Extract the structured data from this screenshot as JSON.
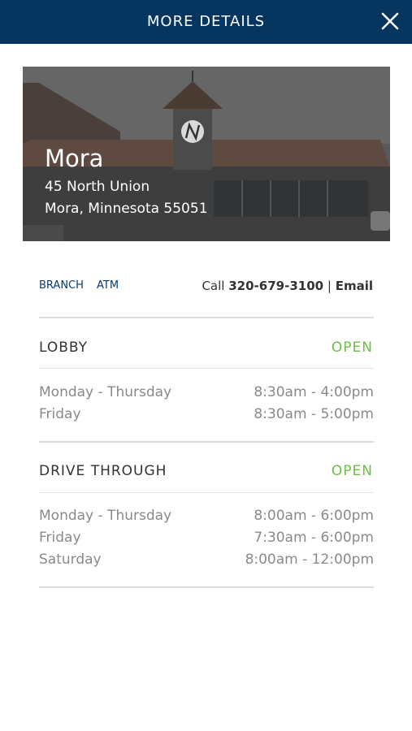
{
  "header": {
    "title": "MORE DETAILS"
  },
  "location": {
    "name": "Mora",
    "address_line1": "45 North Union",
    "address_line2": "Mora, Minnesota 55051"
  },
  "tags": [
    "BRANCH",
    "ATM"
  ],
  "contact": {
    "call_label": "Call",
    "phone": "320-679-3100",
    "separator": "|",
    "email_label": "Email"
  },
  "sections": [
    {
      "title": "LOBBY",
      "status": "OPEN",
      "hours": [
        {
          "day": "Monday - Thursday",
          "time": "8:30am - 4:00pm"
        },
        {
          "day": "Friday",
          "time": "8:30am - 5:00pm"
        }
      ]
    },
    {
      "title": "DRIVE THROUGH",
      "status": "OPEN",
      "hours": [
        {
          "day": "Monday - Thursday",
          "time": "8:00am - 6:00pm"
        },
        {
          "day": "Friday",
          "time": "7:30am - 6:00pm"
        },
        {
          "day": "Saturday",
          "time": "8:00am - 12:00pm"
        }
      ]
    }
  ],
  "colors": {
    "header": "#063560",
    "open": "#6cc04a",
    "tag": "#0b3b66"
  },
  "icons": {
    "close": "close-icon",
    "logo": "bank-logo-icon"
  }
}
